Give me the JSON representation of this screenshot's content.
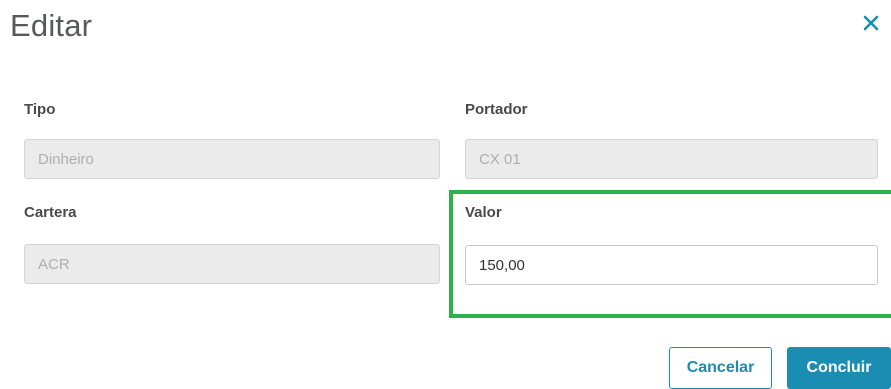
{
  "dialog": {
    "title": "Editar"
  },
  "fields": {
    "tipo": {
      "label": "Tipo",
      "value": "Dinheiro"
    },
    "portador": {
      "label": "Portador",
      "value": "CX 01"
    },
    "cartera": {
      "label": "Cartera",
      "value": "ACR"
    },
    "valor": {
      "label": "Valor",
      "value": "150,00"
    }
  },
  "buttons": {
    "cancel_label": "Cancelar",
    "confirm_label": "Concluir"
  },
  "icons": {
    "close": "close-icon"
  },
  "colors": {
    "accent": "#1c8db2",
    "highlight": "#2bb24c",
    "disabled_bg": "#ebebeb"
  }
}
